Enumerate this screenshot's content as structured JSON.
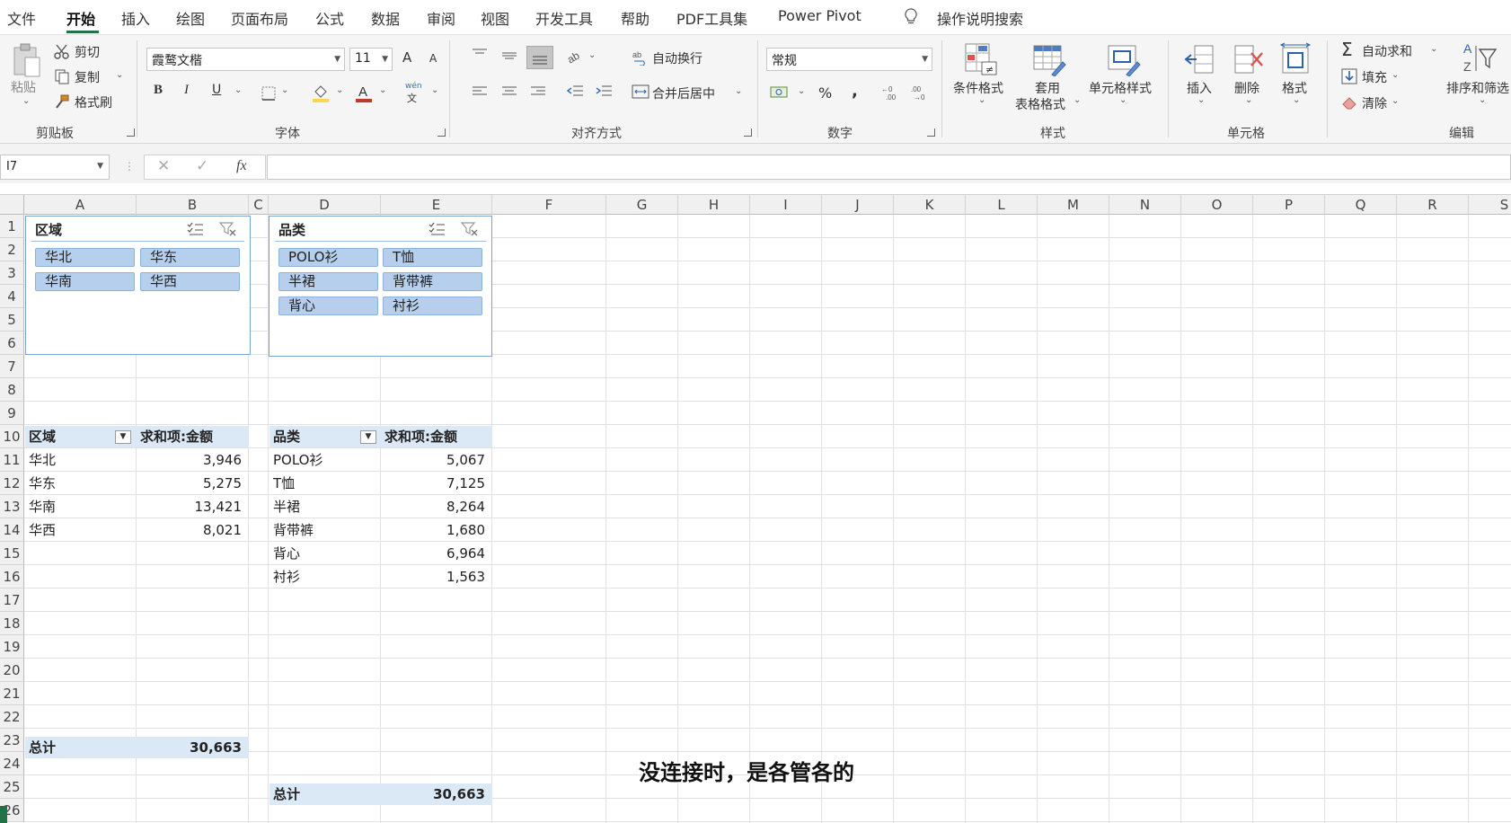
{
  "menu": {
    "tabs": [
      "文件",
      "开始",
      "插入",
      "绘图",
      "页面布局",
      "公式",
      "数据",
      "审阅",
      "视图",
      "开发工具",
      "帮助",
      "PDF工具集",
      "Power Pivot"
    ],
    "active_tab": "开始",
    "search_label": "操作说明搜索"
  },
  "ribbon": {
    "clipboard": {
      "paste": "粘贴",
      "cut": "剪切",
      "copy": "复制",
      "format_painter": "格式刷",
      "label": "剪贴板"
    },
    "font": {
      "name": "霞鹜文楷",
      "size": "11",
      "grow": "A",
      "shrink": "A",
      "bold": "B",
      "italic": "I",
      "underline": "U",
      "label": "字体",
      "phonetic": "wén",
      "phonetic_char": "文"
    },
    "alignment": {
      "wrap": "自动换行",
      "merge": "合并后居中",
      "label": "对齐方式"
    },
    "number": {
      "format": "常规",
      "percent": "%",
      "comma": ",",
      "label": "数字"
    },
    "styles": {
      "conditional": "条件格式",
      "table_line1": "套用",
      "table_line2": "表格格式",
      "cell_styles": "单元格样式",
      "label": "样式"
    },
    "cells": {
      "insert": "插入",
      "delete": "删除",
      "format": "格式",
      "label": "单元格"
    },
    "editing": {
      "autosum": "自动求和",
      "fill": "填充",
      "clear": "清除",
      "sort": "排序和筛选",
      "label": "编辑"
    }
  },
  "formula_bar": {
    "name_box": "I7",
    "fx": "fx",
    "content": ""
  },
  "columns": [
    "A",
    "B",
    "C",
    "D",
    "E",
    "F",
    "G",
    "H",
    "I",
    "J",
    "K",
    "L",
    "M",
    "N",
    "O",
    "P",
    "Q",
    "R",
    "S"
  ],
  "rows": [
    "1",
    "2",
    "3",
    "4",
    "5",
    "6",
    "7",
    "8",
    "9",
    "10",
    "11",
    "12",
    "13",
    "14",
    "15",
    "16",
    "17",
    "18",
    "19",
    "20",
    "21",
    "22",
    "23",
    "24",
    "25",
    "26"
  ],
  "slicer_region": {
    "title": "区域",
    "items": [
      "华北",
      "华东",
      "华南",
      "华西"
    ]
  },
  "slicer_category": {
    "title": "品类",
    "items": [
      "POLO衫",
      "T恤",
      "半裙",
      "背带裤",
      "背心",
      "衬衫"
    ]
  },
  "pivot_region": {
    "header_label": "区域",
    "header_value": "求和项:金额",
    "rows": [
      {
        "label": "华北",
        "value": "3,946"
      },
      {
        "label": "华东",
        "value": "5,275"
      },
      {
        "label": "华南",
        "value": "13,421"
      },
      {
        "label": "华西",
        "value": "8,021"
      }
    ],
    "total_label": "总计",
    "total_value": "30,663"
  },
  "pivot_category": {
    "header_label": "品类",
    "header_value": "求和项:金额",
    "rows": [
      {
        "label": "POLO衫",
        "value": "5,067"
      },
      {
        "label": "T恤",
        "value": "7,125"
      },
      {
        "label": "半裙",
        "value": "8,264"
      },
      {
        "label": "背带裤",
        "value": "1,680"
      },
      {
        "label": "背心",
        "value": "6,964"
      },
      {
        "label": "衬衫",
        "value": "1,563"
      }
    ],
    "total_label": "总计",
    "total_value": "30,663"
  },
  "subtitle": "没连接时，是各管各的",
  "colors": {
    "accent": "#217346",
    "pivot_header": "#dbe8f5",
    "slicer_button": "#b6cfec",
    "slicer_border": "#7aa4cf"
  }
}
